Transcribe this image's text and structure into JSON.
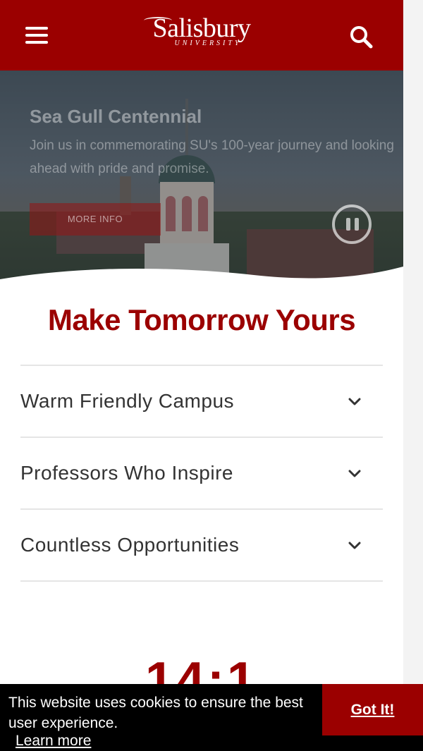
{
  "header": {
    "brand_name": "Salisbury",
    "brand_sub": "UNIVERSITY",
    "icons": {
      "menu": "hamburger-menu-icon",
      "search": "search-icon"
    },
    "colors": {
      "brand": "#9b0000"
    }
  },
  "hero": {
    "title": "Sea Gull Centennial",
    "subtitle": "Join us in commemorating SU's 100-year journey and looking ahead with pride and promise.",
    "button_label": "MORE INFO",
    "pause_icon": "pause-icon"
  },
  "main": {
    "headline": "Make Tomorrow Yours",
    "accordion": [
      {
        "label": "Warm Friendly Campus",
        "icon": "chevron-down-icon"
      },
      {
        "label": "Professors Who Inspire",
        "icon": "chevron-down-icon"
      },
      {
        "label": "Countless Opportunities",
        "icon": "chevron-down-icon"
      }
    ],
    "stat_value": "14:1"
  },
  "cookie_banner": {
    "message": "This website uses cookies to ensure the best user experience.",
    "learn_more": "Learn more",
    "accept_label": "Got It!"
  }
}
